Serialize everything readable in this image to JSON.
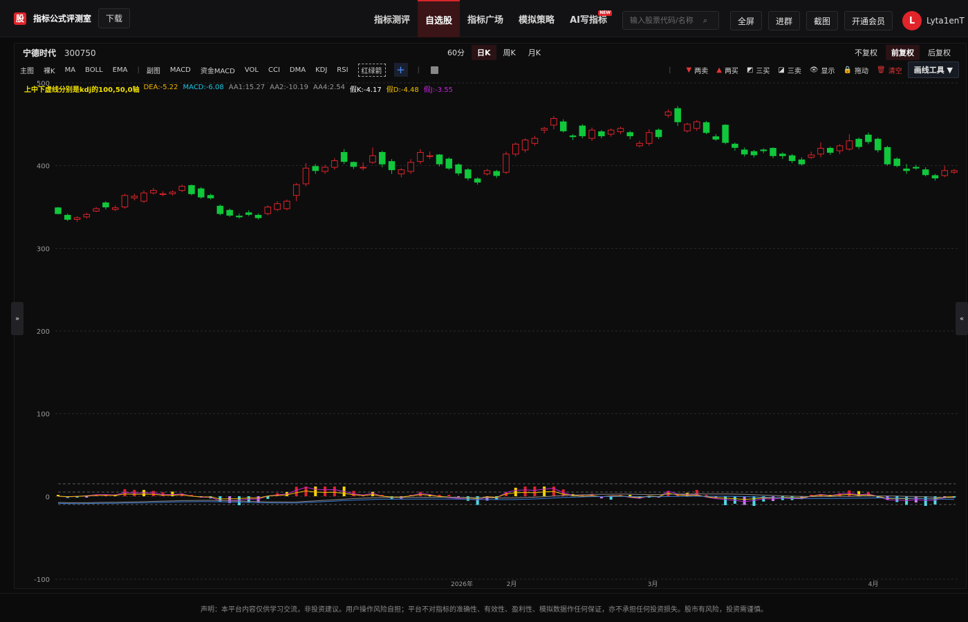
{
  "brand": {
    "logo": "股",
    "name": "指标公式评测室",
    "download": "下载"
  },
  "nav": {
    "tabs": [
      {
        "label": "指标测评",
        "active": false
      },
      {
        "label": "自选股",
        "active": true
      },
      {
        "label": "指标广场",
        "active": false
      },
      {
        "label": "模拟策略",
        "active": false
      },
      {
        "label": "AI写指标",
        "active": false,
        "badge": "NEW"
      }
    ],
    "search_placeholder": "输入股票代码/名称",
    "buttons": [
      "全屏",
      "进群",
      "截图",
      "开通会员"
    ],
    "user": {
      "initial": "L",
      "name": "Lyta1enT"
    }
  },
  "stock": {
    "name": "宁德时代",
    "code": "300750"
  },
  "periods": [
    {
      "label": "60分",
      "active": false
    },
    {
      "label": "日K",
      "active": true
    },
    {
      "label": "周K",
      "active": false
    },
    {
      "label": "月K",
      "active": false
    }
  ],
  "adjust": [
    {
      "label": "不复权",
      "active": false
    },
    {
      "label": "前复权",
      "active": true
    },
    {
      "label": "后复权",
      "active": false
    }
  ],
  "toolbar": {
    "main_items": [
      "主图",
      "裸K",
      "MA",
      "BOLL",
      "EMA"
    ],
    "sub_label": "副图",
    "sub_items": [
      "MACD",
      "资金MACD",
      "VOL",
      "CCI",
      "DMA",
      "KDJ",
      "RSI"
    ],
    "selected_indicator": "红绿箭",
    "add_symbol": "+"
  },
  "draw_tools": {
    "items": [
      {
        "icon": "down-triangle-icon",
        "glyph": "▼",
        "label": "两卖",
        "color": "#e53434"
      },
      {
        "icon": "up-triangle-icon",
        "glyph": "▲",
        "label": "两买",
        "color": "#e53434"
      },
      {
        "icon": "line-up-icon",
        "glyph": "◩",
        "label": "三买",
        "color": "#d8d8d8"
      },
      {
        "icon": "line-down-icon",
        "glyph": "◪",
        "label": "三卖",
        "color": "#d8d8d8"
      }
    ],
    "show": "显示",
    "drag": "拖动",
    "clear": "清空",
    "button": "画线工具 ▼"
  },
  "legend": {
    "note": "上中下虚线分别是kdj的100,50,0轴",
    "items": [
      {
        "text": "DEA:-5.22",
        "color": "#f0b400"
      },
      {
        "text": "MACD:-6.08",
        "color": "#19c6e0"
      },
      {
        "text": "AA1:15.27",
        "color": "#9a9a9a"
      },
      {
        "text": "AA2:-10.19",
        "color": "#9a9a9a"
      },
      {
        "text": "AA4:2.54",
        "color": "#9a9a9a"
      },
      {
        "text": "假K:-4.17",
        "color": "#ffffff"
      },
      {
        "text": "假D:-4.48",
        "color": "#f0c000"
      },
      {
        "text": "假J:-3.55",
        "color": "#c026d3"
      }
    ]
  },
  "chart_data": {
    "type": "candlestick",
    "y_ticks": [
      500,
      400,
      300,
      200,
      100,
      0,
      -100
    ],
    "ylim": [
      -100,
      500
    ],
    "x_labels": [
      "2026年",
      "2月",
      "3月",
      "4月"
    ],
    "up_color": "#e0242a",
    "down_color": "#11c73b",
    "candles": [
      [
        349,
        342,
        350,
        341
      ],
      [
        340,
        335,
        342,
        333
      ],
      [
        335,
        337,
        339,
        332
      ],
      [
        338,
        341,
        343,
        336
      ],
      [
        345,
        348,
        350,
        344
      ],
      [
        355,
        350,
        357,
        347
      ],
      [
        347,
        349,
        352,
        345
      ],
      [
        350,
        364,
        366,
        348
      ],
      [
        361,
        363,
        366,
        358
      ],
      [
        357,
        367,
        370,
        355
      ],
      [
        367,
        370,
        373,
        365
      ],
      [
        365,
        366,
        369,
        363
      ],
      [
        366,
        368,
        370,
        364
      ],
      [
        370,
        375,
        377,
        368
      ],
      [
        376,
        366,
        377,
        364
      ],
      [
        372,
        362,
        374,
        360
      ],
      [
        364,
        361,
        366,
        359
      ],
      [
        351,
        342,
        353,
        340
      ],
      [
        346,
        340,
        348,
        338
      ],
      [
        339,
        338,
        342,
        336
      ],
      [
        343,
        341,
        346,
        339
      ],
      [
        340,
        337,
        342,
        335
      ],
      [
        342,
        350,
        352,
        340
      ],
      [
        347,
        354,
        357,
        345
      ],
      [
        348,
        357,
        359,
        346
      ],
      [
        364,
        377,
        379,
        357
      ],
      [
        378,
        397,
        403,
        375
      ],
      [
        399,
        394,
        402,
        390
      ],
      [
        393,
        398,
        401,
        390
      ],
      [
        398,
        406,
        409,
        395
      ],
      [
        416,
        405,
        420,
        402
      ],
      [
        404,
        399,
        405,
        396
      ],
      [
        398,
        398,
        404,
        394
      ],
      [
        404,
        412,
        422,
        402
      ],
      [
        416,
        402,
        418,
        398
      ],
      [
        405,
        395,
        408,
        390
      ],
      [
        390,
        395,
        397,
        386
      ],
      [
        393,
        404,
        408,
        390
      ],
      [
        405,
        416,
        420,
        402
      ],
      [
        411,
        412,
        417,
        408
      ],
      [
        413,
        402,
        414,
        399
      ],
      [
        408,
        397,
        410,
        395
      ],
      [
        401,
        391,
        403,
        388
      ],
      [
        395,
        385,
        397,
        382
      ],
      [
        384,
        380,
        386,
        377
      ],
      [
        390,
        394,
        396,
        388
      ],
      [
        393,
        388,
        395,
        385
      ],
      [
        392,
        414,
        417,
        390
      ],
      [
        414,
        426,
        428,
        411
      ],
      [
        419,
        431,
        433,
        416
      ],
      [
        427,
        433,
        436,
        424
      ],
      [
        443,
        445,
        447,
        439
      ],
      [
        449,
        457,
        460,
        444
      ],
      [
        453,
        442,
        456,
        440
      ],
      [
        436,
        435,
        438,
        431
      ],
      [
        448,
        436,
        450,
        433
      ],
      [
        433,
        443,
        446,
        430
      ],
      [
        441,
        436,
        443,
        433
      ],
      [
        438,
        443,
        445,
        435
      ],
      [
        441,
        445,
        447,
        438
      ],
      [
        440,
        436,
        442,
        432
      ],
      [
        424,
        427,
        430,
        422
      ],
      [
        427,
        440,
        444,
        424
      ],
      [
        443,
        435,
        445,
        432
      ],
      [
        461,
        465,
        468,
        458
      ],
      [
        469,
        453,
        472,
        448
      ],
      [
        442,
        450,
        452,
        440
      ],
      [
        445,
        453,
        455,
        442
      ],
      [
        452,
        440,
        454,
        438
      ],
      [
        435,
        432,
        438,
        430
      ],
      [
        449,
        428,
        450,
        426
      ],
      [
        426,
        422,
        428,
        418
      ],
      [
        419,
        414,
        422,
        411
      ],
      [
        417,
        413,
        419,
        410
      ],
      [
        419,
        418,
        421,
        415
      ],
      [
        421,
        412,
        422,
        409
      ],
      [
        414,
        412,
        416,
        408
      ],
      [
        412,
        406,
        414,
        403
      ],
      [
        407,
        402,
        410,
        400
      ],
      [
        410,
        413,
        417,
        408
      ],
      [
        414,
        421,
        428,
        410
      ],
      [
        421,
        416,
        423,
        413
      ],
      [
        418,
        424,
        426,
        414
      ],
      [
        420,
        430,
        438,
        418
      ],
      [
        432,
        423,
        434,
        420
      ],
      [
        437,
        429,
        440,
        426
      ],
      [
        432,
        419,
        434,
        416
      ],
      [
        422,
        402,
        424,
        400
      ],
      [
        408,
        400,
        410,
        398
      ],
      [
        396,
        394,
        402,
        390
      ],
      [
        398,
        397,
        401,
        395
      ],
      [
        395,
        389,
        398,
        387
      ],
      [
        388,
        385,
        390,
        382
      ],
      [
        388,
        394,
        400,
        386
      ],
      [
        392,
        394,
        396,
        390
      ]
    ],
    "sub_indicator": {
      "name": "红绿箭",
      "zero_axis": 0,
      "dashed_axes": [
        100,
        50,
        0
      ]
    }
  },
  "disclaimer": "声明：本平台内容仅供学习交流，非投资建议。用户操作风险自担；平台不对指标的准确性、有效性、盈利性、模拟数据作任何保证，亦不承担任何投资损失。股市有风险，投资需谨慎。"
}
